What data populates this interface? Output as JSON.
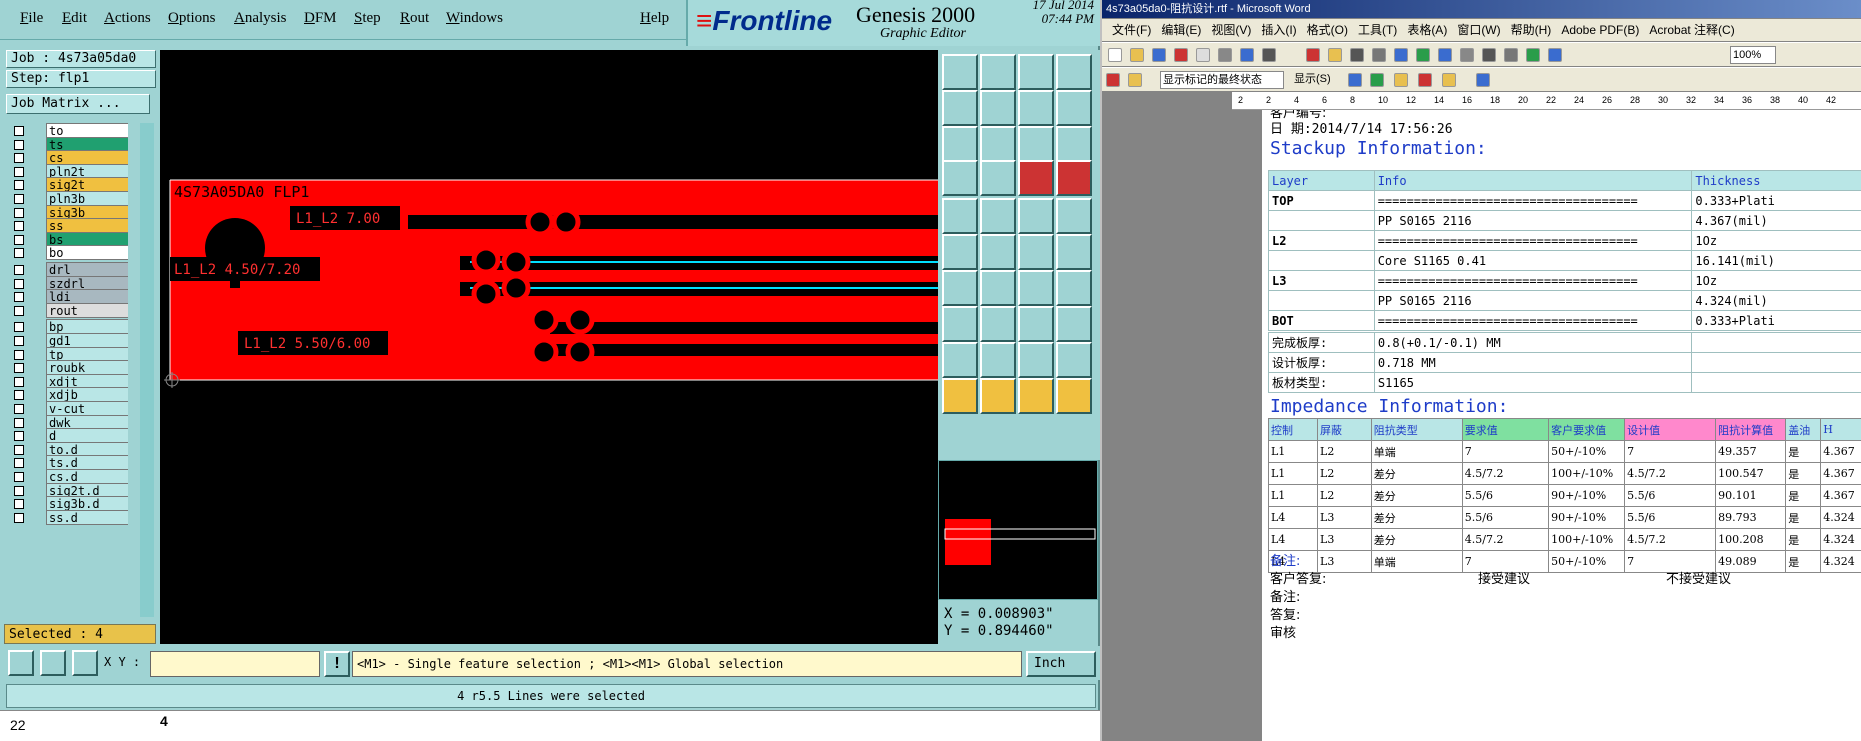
{
  "genesis": {
    "menu": [
      "File",
      "Edit",
      "Actions",
      "Options",
      "Analysis",
      "DFM",
      "Step",
      "Rout",
      "Windows"
    ],
    "help": "Help",
    "brand": {
      "logo": "Frontline",
      "product": "Genesis 2000",
      "subtitle": "Graphic Editor",
      "date": "17 Jul 2014",
      "time": "07:44 PM"
    },
    "job_label": "Job : 4s73a05da0",
    "step_label": "Step: flp1",
    "job_matrix": "Job Matrix ...",
    "layers": [
      {
        "name": "to",
        "color": "#ffffff"
      },
      {
        "name": "ts",
        "color": "#20a070"
      },
      {
        "name": "cs",
        "color": "#f0c040"
      },
      {
        "name": "pln2t",
        "color": "#b9e6e6"
      },
      {
        "name": "sig2t",
        "color": "#f0c040"
      },
      {
        "name": "pln3b",
        "color": "#b9e6e6"
      },
      {
        "name": "sig3b",
        "color": "#f0c040"
      },
      {
        "name": "ss",
        "color": "#f0c040"
      },
      {
        "name": "bs",
        "color": "#20a070"
      },
      {
        "name": "bo",
        "color": "#ffffff"
      },
      {
        "name": "drl",
        "color": "#a8b8c0"
      },
      {
        "name": "szdrl",
        "color": "#a8b8c0"
      },
      {
        "name": "ldi",
        "color": "#a8b8c0"
      },
      {
        "name": "rout",
        "color": "#dddddd"
      },
      {
        "name": "bp",
        "color": "#b9e6e6"
      },
      {
        "name": "gd1",
        "color": "#b9e6e6"
      },
      {
        "name": "tp",
        "color": "#b9e6e6"
      },
      {
        "name": "roubk",
        "color": "#b9e6e6"
      },
      {
        "name": "xdjt",
        "color": "#b9e6e6"
      },
      {
        "name": "xdjb",
        "color": "#b9e6e6"
      },
      {
        "name": "v-cut",
        "color": "#b9e6e6"
      },
      {
        "name": "dwk",
        "color": "#b9e6e6"
      },
      {
        "name": "d",
        "color": "#b9e6e6"
      },
      {
        "name": "to.d",
        "color": "#b9e6e6"
      },
      {
        "name": "ts.d",
        "color": "#b9e6e6"
      },
      {
        "name": "cs.d",
        "color": "#b9e6e6"
      },
      {
        "name": "sig2t.d",
        "color": "#b9e6e6"
      },
      {
        "name": "sig3b.d",
        "color": "#b9e6e6"
      },
      {
        "name": "ss.d",
        "color": "#b9e6e6"
      }
    ],
    "selected": "Selected : 4",
    "canvas_labels": {
      "title": "4S73A05DA0 FLP1",
      "l1": "L1_L2 7.00",
      "l2": "L1_L2 4.50/7.20",
      "l3": "L1_L2 5.50/6.00"
    },
    "coords": {
      "x": "X = 0.008903\"",
      "y": "Y = 0.894460\""
    },
    "xy_label": "X Y :",
    "message": "<M1> - Single feature selection ; <M1><M1> Global selection",
    "unit": "Inch",
    "status": "4 r5.5 Lines were selected",
    "sheet_row": "22",
    "sheet_cell": "4"
  },
  "word": {
    "title": "4s73a05da0-阻抗设计.rtf - Microsoft Word",
    "menu": [
      "文件(F)",
      "编辑(E)",
      "视图(V)",
      "插入(I)",
      "格式(O)",
      "工具(T)",
      "表格(A)",
      "窗口(W)",
      "帮助(H)",
      "Adobe PDF(B)",
      "Acrobat 注释(C)"
    ],
    "zoom": "100%",
    "markup_mode": "显示标记的最终状态",
    "show_label": "显示(S)",
    "ruler": [
      "2",
      "2",
      "4",
      "6",
      "8",
      "10",
      "12",
      "14",
      "16",
      "18",
      "20",
      "22",
      "24",
      "26",
      "28",
      "30",
      "32",
      "34",
      "36",
      "38",
      "40",
      "42"
    ],
    "customer_no": "客户编号:",
    "date_line": "日    期:2014/7/14 17:56:26",
    "stackup_title": "Stackup Information:",
    "stackup_headers": [
      "Layer",
      "Info",
      "Thickness"
    ],
    "stackup_rows": [
      [
        "TOP",
        "====================================",
        "0.333+Plati"
      ],
      [
        "",
        "PP      S0165      2116",
        "4.367(mil)"
      ],
      [
        "L2",
        "====================================",
        "1Oz"
      ],
      [
        "",
        "Core      S1165      0.41",
        "16.141(mil)"
      ],
      [
        "L3",
        "====================================",
        "1Oz"
      ],
      [
        "",
        "PP      S0165      2116",
        "4.324(mil)"
      ],
      [
        "BOT",
        "====================================",
        "0.333+Plati"
      ]
    ],
    "board_rows": [
      [
        "完成板厚:",
        "0.8(+0.1/-0.1) MM"
      ],
      [
        "设计板厚:",
        "0.718 MM"
      ],
      [
        "板材类型:",
        "S1165"
      ]
    ],
    "impedance_title": "Impedance Information:",
    "imp_headers": [
      "控制",
      "屏蔽",
      "阻抗类型",
      "要求值",
      "客户要求值",
      "设计值",
      "阻抗计算值",
      "盖油",
      "H"
    ],
    "imp_rows": [
      [
        "L1",
        "L2",
        "单端",
        "7",
        "50+/-10%",
        "7",
        "49.357",
        "是",
        "4.367"
      ],
      [
        "L1",
        "L2",
        "差分",
        "4.5/7.2",
        "100+/-10%",
        "4.5/7.2",
        "100.547",
        "是",
        "4.367"
      ],
      [
        "L1",
        "L2",
        "差分",
        "5.5/6",
        "90+/-10%",
        "5.5/6",
        "90.101",
        "是",
        "4.367"
      ],
      [
        "L4",
        "L3",
        "差分",
        "5.5/6",
        "90+/-10%",
        "5.5/6",
        "89.793",
        "是",
        "4.324"
      ],
      [
        "L4",
        "L3",
        "差分",
        "4.5/7.2",
        "100+/-10%",
        "4.5/7.2",
        "100.208",
        "是",
        "4.324"
      ],
      [
        "L4",
        "L3",
        "单端",
        "7",
        "50+/-10%",
        "7",
        "49.089",
        "是",
        "4.324"
      ]
    ],
    "notes_label": "备注:",
    "reply_label": "客户答复:",
    "accept": "接受建议",
    "reject": "不接受建议",
    "notes2": "备注:",
    "reply2": "答复:",
    "tail": "审核"
  }
}
